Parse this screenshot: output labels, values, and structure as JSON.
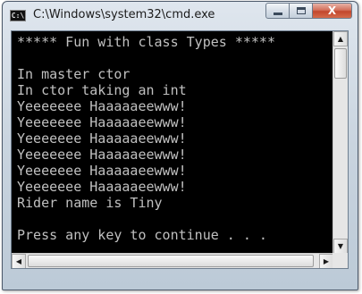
{
  "window": {
    "title": "C:\\Windows\\system32\\cmd.exe",
    "icon": "console-app-icon",
    "icon_text": "C:\\"
  },
  "caption_buttons": {
    "minimize": "minimize-icon",
    "maximize": "maximize-icon",
    "close": "close-icon",
    "close_glyph": "X"
  },
  "console": {
    "lines": [
      "***** Fun with class Types *****",
      "",
      "In master ctor",
      "In ctor taking an int",
      "Yeeeeeee Haaaaaeewww!",
      "Yeeeeeee Haaaaaeewww!",
      "Yeeeeeee Haaaaaeewww!",
      "Yeeeeeee Haaaaaeewww!",
      "Yeeeeeee Haaaaaeewww!",
      "Yeeeeeee Haaaaaeewww!",
      "Rider name is Tiny",
      "",
      "Press any key to continue . . ."
    ],
    "text_color": "#c0c0c0",
    "background": "#000000"
  },
  "scrollbars": {
    "up_glyph": "▲",
    "down_glyph": "▼",
    "left_glyph": "◀",
    "right_glyph": "▶"
  }
}
